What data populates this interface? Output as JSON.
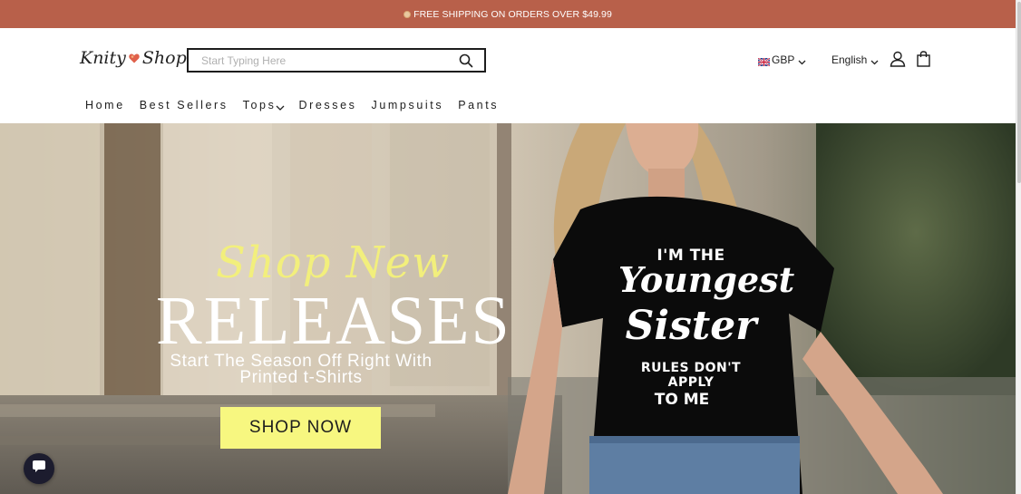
{
  "announcement": {
    "text": "FREE SHIPPING ON ORDERS OVER $49.99"
  },
  "header": {
    "logo_left": "Knity",
    "logo_right": "Shop",
    "search_placeholder": "Start Typing Here",
    "currency": "GBP",
    "language": "English"
  },
  "nav": {
    "items": [
      {
        "label": "Home"
      },
      {
        "label": "Best Sellers"
      },
      {
        "label": "Tops"
      },
      {
        "label": "Dresses"
      },
      {
        "label": "Jumpsuits"
      },
      {
        "label": "Pants"
      }
    ]
  },
  "hero": {
    "script_heading": "Shop New",
    "title": "RELEASES",
    "subtitle_line1": "Start The Season Off Right With",
    "subtitle_line2": "Printed t-Shirts",
    "button_label": "SHOP NOW",
    "shirt": {
      "line1": "I'M THE",
      "line2": "Youngest",
      "line3": "Sister",
      "line4": "RULES DON'T APPLY",
      "line5": "TO ME"
    }
  },
  "colors": {
    "announcement_bg": "#b8604a",
    "button_bg": "#f7f780",
    "script_yellow": "#f2ef7c"
  },
  "icons": [
    "globe-icon",
    "heart-logo-icon",
    "search-icon",
    "uk-flag-icon",
    "chevron-down-icon",
    "user-icon",
    "shopping-bag-icon",
    "chat-icon"
  ]
}
